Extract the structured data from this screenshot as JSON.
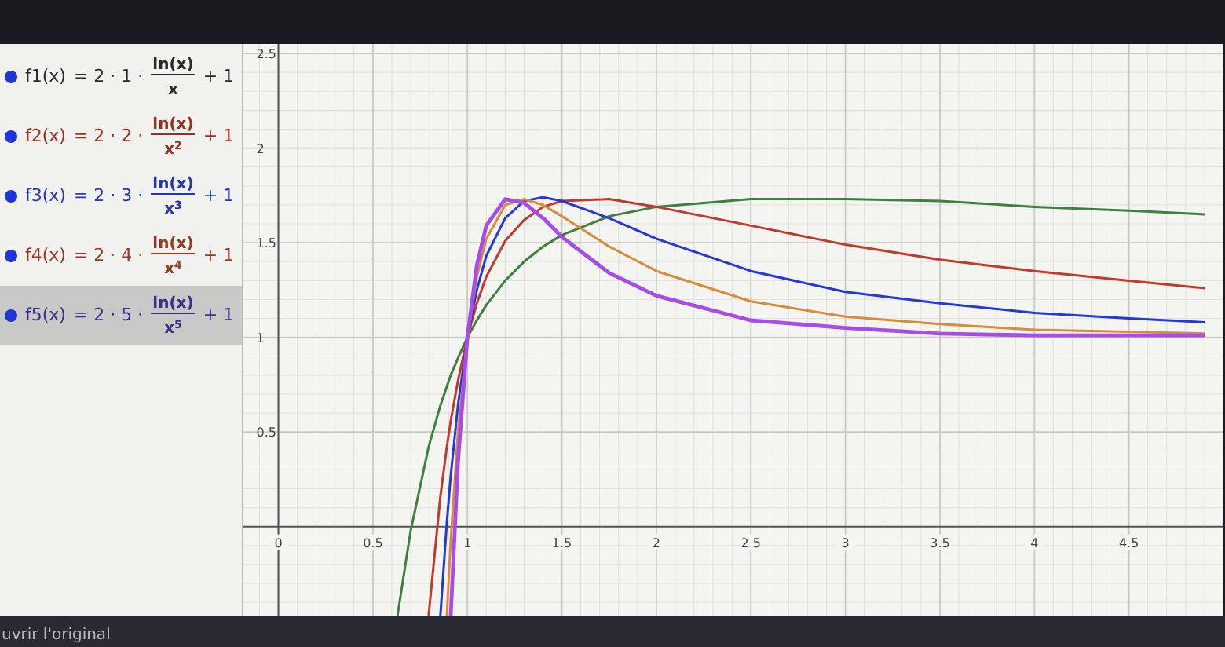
{
  "algebra": {
    "items": [
      {
        "name": "f1(x)",
        "expression": "= 2 · 1 ·",
        "numerator": "ln(x)",
        "denominator": "x",
        "suffix": "+ 1",
        "color": "#2a2a2a",
        "selected": false
      },
      {
        "name": "f2(x)",
        "expression": "= 2 · 2 ·",
        "numerator": "ln(x)",
        "denominator": "x$^{2}$",
        "suffix": "+ 1",
        "color": "#9a2f22",
        "selected": false
      },
      {
        "name": "f3(x)",
        "expression": "= 2 · 3 ·",
        "numerator": "ln(x)",
        "denominator": "x$^{3}$",
        "suffix": "+ 1",
        "color": "#2436b8",
        "selected": false
      },
      {
        "name": "f4(x)",
        "expression": "= 2 · 4 ·",
        "numerator": "ln(x)",
        "denominator": "x$^{4}$",
        "suffix": "+ 1",
        "color": "#9a3a22",
        "selected": false
      },
      {
        "name": "f5(x)",
        "expression": "= 2 · 5 ·",
        "numerator": "ln(x)",
        "denominator": "x$^{5}$",
        "suffix": "+ 1",
        "color": "#3a2f8a",
        "selected": true
      }
    ]
  },
  "graph": {
    "chart_data": {
      "type": "line",
      "xlim": [
        -0.185,
        5.0
      ],
      "ylim": [
        -0.47,
        2.55
      ],
      "grid": true,
      "xticks": [
        0,
        0.5,
        1,
        1.5,
        2,
        2.5,
        3,
        3.5,
        4,
        4.5
      ],
      "yticks": [
        0.5,
        1,
        1.5,
        2,
        2.5
      ],
      "x": [
        0.63,
        0.7,
        0.795,
        0.857,
        0.891,
        0.912,
        0.95,
        1,
        1.05,
        1.1,
        1.2,
        1.3,
        1.4,
        1.5,
        1.75,
        2,
        2.5,
        3,
        3.5,
        4,
        4.5,
        4.9
      ],
      "series": [
        {
          "color": "#3f7f3f",
          "values": [
            -0.47,
            -0.02,
            0.42,
            0.64,
            0.74,
            0.8,
            0.89,
            1,
            1.09,
            1.17,
            1.3,
            1.4,
            1.48,
            1.54,
            1.64,
            1.69,
            1.73,
            1.73,
            1.72,
            1.69,
            1.67,
            1.65
          ]
        },
        {
          "color": "#c0392b",
          "values": [
            null,
            null,
            -0.47,
            0.16,
            0.42,
            0.56,
            0.77,
            1,
            1.18,
            1.32,
            1.51,
            1.62,
            1.69,
            1.72,
            1.73,
            1.69,
            1.59,
            1.49,
            1.41,
            1.35,
            1.3,
            1.26
          ]
        },
        {
          "color": "#2238d8",
          "values": [
            null,
            null,
            null,
            -0.47,
            0.02,
            0.27,
            0.64,
            1,
            1.25,
            1.43,
            1.63,
            1.72,
            1.74,
            1.72,
            1.63,
            1.52,
            1.35,
            1.24,
            1.18,
            1.13,
            1.1,
            1.08
          ]
        },
        {
          "color": "#d98a3a",
          "values": [
            null,
            null,
            null,
            null,
            -0.47,
            -0.07,
            0.5,
            1,
            1.32,
            1.52,
            1.7,
            1.73,
            1.7,
            1.64,
            1.48,
            1.35,
            1.19,
            1.11,
            1.07,
            1.04,
            1.03,
            1.02
          ]
        },
        {
          "color": "#a64de6",
          "values": [
            null,
            null,
            null,
            null,
            null,
            -0.47,
            0.34,
            1,
            1.38,
            1.59,
            1.73,
            1.71,
            1.63,
            1.53,
            1.34,
            1.22,
            1.09,
            1.05,
            1.02,
            1.01,
            1.01,
            1.01
          ]
        }
      ]
    }
  },
  "footer": {
    "link": "uvrir l'original"
  }
}
